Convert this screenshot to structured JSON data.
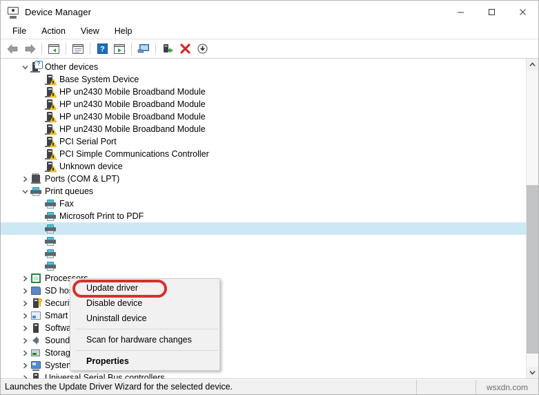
{
  "window": {
    "title": "Device Manager",
    "icon": "device-manager-icon",
    "controls": {
      "minimize": "minimize-icon",
      "maximize": "maximize-icon",
      "close": "close-icon"
    }
  },
  "menubar": {
    "items": [
      {
        "label": "File"
      },
      {
        "label": "Action"
      },
      {
        "label": "View"
      },
      {
        "label": "Help"
      }
    ]
  },
  "toolbar": {
    "buttons": [
      {
        "name": "back-icon",
        "title": "Back"
      },
      {
        "name": "forward-icon",
        "title": "Forward"
      },
      {
        "name": "show-hide-console-tree-icon",
        "title": "Show/Hide Console Tree"
      },
      {
        "name": "properties-icon",
        "title": "Properties"
      },
      {
        "name": "help-icon",
        "title": "Help"
      },
      {
        "name": "view-icon",
        "title": "View"
      },
      {
        "name": "scan-for-hardware-changes-icon",
        "title": "Scan for hardware changes"
      },
      {
        "name": "update-driver-icon",
        "title": "Update Driver Software"
      },
      {
        "name": "uninstall-device-icon",
        "title": "Uninstall device"
      },
      {
        "name": "disable-device-icon",
        "title": "Disable device"
      }
    ]
  },
  "tree": {
    "nodes": [
      {
        "label": "Other devices",
        "level": 0,
        "icon": "unknown-device-icon",
        "expander": "expanded",
        "selected": false
      },
      {
        "label": "Base System Device",
        "level": 1,
        "icon": "warning-device-icon",
        "expander": "none",
        "selected": false
      },
      {
        "label": "HP un2430 Mobile Broadband Module",
        "level": 1,
        "icon": "warning-device-icon",
        "expander": "none",
        "selected": false
      },
      {
        "label": "HP un2430 Mobile Broadband Module",
        "level": 1,
        "icon": "warning-device-icon",
        "expander": "none",
        "selected": false
      },
      {
        "label": "HP un2430 Mobile Broadband Module",
        "level": 1,
        "icon": "warning-device-icon",
        "expander": "none",
        "selected": false
      },
      {
        "label": "HP un2430 Mobile Broadband Module",
        "level": 1,
        "icon": "warning-device-icon",
        "expander": "none",
        "selected": false
      },
      {
        "label": "PCI Serial Port",
        "level": 1,
        "icon": "warning-device-icon",
        "expander": "none",
        "selected": false
      },
      {
        "label": "PCI Simple Communications Controller",
        "level": 1,
        "icon": "warning-device-icon",
        "expander": "none",
        "selected": false
      },
      {
        "label": "Unknown device",
        "level": 1,
        "icon": "warning-device-icon",
        "expander": "none",
        "selected": false
      },
      {
        "label": "Ports (COM & LPT)",
        "level": 0,
        "icon": "port-icon",
        "expander": "collapsed",
        "selected": false
      },
      {
        "label": "Print queues",
        "level": 0,
        "icon": "printer-icon",
        "expander": "expanded",
        "selected": false
      },
      {
        "label": "Fax",
        "level": 1,
        "icon": "printer-icon",
        "expander": "none",
        "selected": false
      },
      {
        "label": "Microsoft Print to PDF",
        "level": 1,
        "icon": "printer-icon",
        "expander": "none",
        "selected": false
      },
      {
        "label": "",
        "level": 1,
        "icon": "printer-icon",
        "expander": "none",
        "selected": true
      },
      {
        "label": "",
        "level": 1,
        "icon": "printer-icon",
        "expander": "none",
        "selected": false
      },
      {
        "label": "",
        "level": 1,
        "icon": "printer-icon",
        "expander": "none",
        "selected": false
      },
      {
        "label": "",
        "level": 1,
        "icon": "printer-icon",
        "expander": "none",
        "selected": false
      },
      {
        "label": "Processors",
        "level": 0,
        "icon": "processor-icon",
        "expander": "collapsed",
        "selected": false
      },
      {
        "label": "SD host adapters",
        "level": 0,
        "icon": "sd-card-icon",
        "expander": "collapsed",
        "selected": false
      },
      {
        "label": "Security devices",
        "level": 0,
        "icon": "security-key-icon",
        "expander": "collapsed",
        "selected": false
      },
      {
        "label": "Smart card readers",
        "level": 0,
        "icon": "smart-card-reader-icon",
        "expander": "collapsed",
        "selected": false
      },
      {
        "label": "Software devices",
        "level": 0,
        "icon": "software-device-icon",
        "expander": "collapsed",
        "selected": false
      },
      {
        "label": "Sound, video and game controllers",
        "level": 0,
        "icon": "speaker-icon",
        "expander": "collapsed",
        "selected": false
      },
      {
        "label": "Storage controllers",
        "level": 0,
        "icon": "storage-controller-icon",
        "expander": "collapsed",
        "selected": false
      },
      {
        "label": "System devices",
        "level": 0,
        "icon": "system-device-icon",
        "expander": "collapsed",
        "selected": false
      },
      {
        "label": "Universal Serial Bus controllers",
        "level": 0,
        "icon": "usb-icon",
        "expander": "collapsed",
        "selected": false
      }
    ]
  },
  "context_menu": {
    "highlight_color": "#d8302c",
    "items": [
      {
        "label": "Update driver",
        "bold": false,
        "highlighted": true,
        "separator_after": false
      },
      {
        "label": "Disable device",
        "bold": false,
        "highlighted": false,
        "separator_after": false
      },
      {
        "label": "Uninstall device",
        "bold": false,
        "highlighted": false,
        "separator_after": true
      },
      {
        "label": "Scan for hardware changes",
        "bold": false,
        "highlighted": false,
        "separator_after": true
      },
      {
        "label": "Properties",
        "bold": true,
        "highlighted": false,
        "separator_after": false
      }
    ]
  },
  "scrollbar": {
    "up_arrow": "chevron-up-icon",
    "down_arrow": "chevron-down-icon",
    "thumb_top_pct": 38,
    "thumb_height_pct": 56
  },
  "statusbar": {
    "message": "Launches the Update Driver Wizard for the selected device.",
    "watermark": "wsxdn.com"
  }
}
